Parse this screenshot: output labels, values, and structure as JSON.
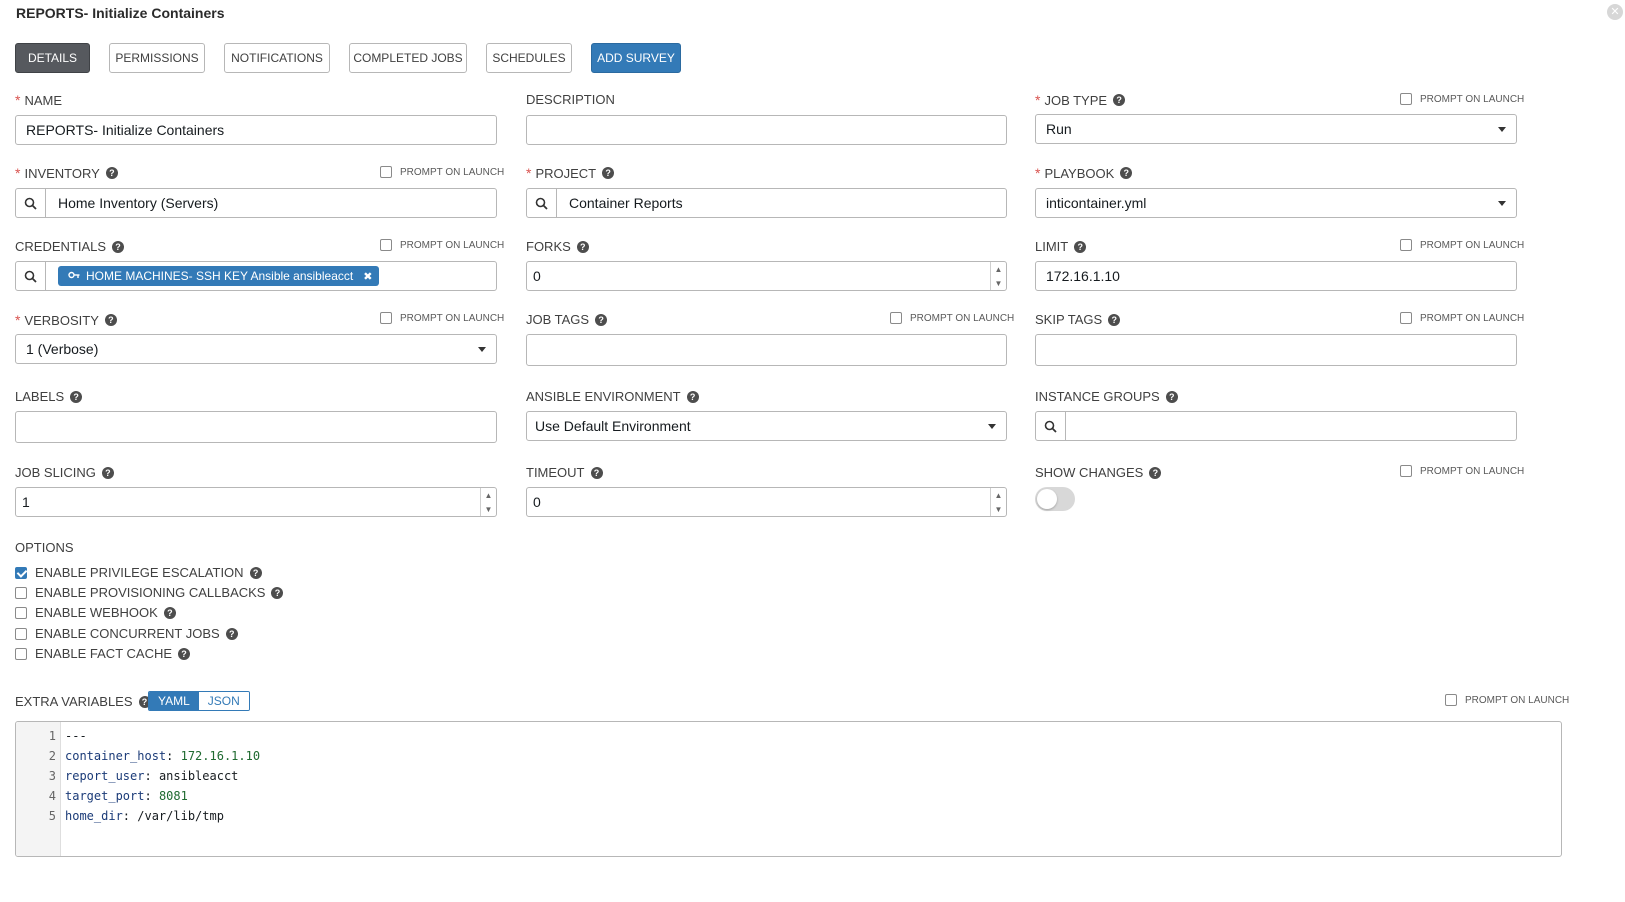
{
  "header": {
    "title": "REPORTS- Initialize Containers"
  },
  "tabs": [
    {
      "label": "DETAILS"
    },
    {
      "label": "PERMISSIONS"
    },
    {
      "label": "NOTIFICATIONS"
    },
    {
      "label": "COMPLETED JOBS"
    },
    {
      "label": "SCHEDULES"
    },
    {
      "label": "ADD SURVEY"
    }
  ],
  "prompt_on_launch": "PROMPT ON LAUNCH",
  "fields": {
    "name": {
      "label": "NAME",
      "value": "REPORTS- Initialize Containers"
    },
    "description": {
      "label": "DESCRIPTION",
      "value": ""
    },
    "job_type": {
      "label": "JOB TYPE",
      "value": "Run"
    },
    "inventory": {
      "label": "INVENTORY",
      "value": "Home Inventory (Servers)"
    },
    "project": {
      "label": "PROJECT",
      "value": "Container Reports"
    },
    "playbook": {
      "label": "PLAYBOOK",
      "value": "inticontainer.yml"
    },
    "credentials": {
      "label": "CREDENTIALS",
      "chip": "HOME MACHINES- SSH KEY Ansible ansibleacct"
    },
    "forks": {
      "label": "FORKS",
      "value": "0"
    },
    "limit": {
      "label": "LIMIT",
      "value": "172.16.1.10"
    },
    "verbosity": {
      "label": "VERBOSITY",
      "value": "1 (Verbose)"
    },
    "job_tags": {
      "label": "JOB TAGS",
      "value": ""
    },
    "skip_tags": {
      "label": "SKIP TAGS",
      "value": ""
    },
    "labels": {
      "label": "LABELS",
      "value": ""
    },
    "ansible_environment": {
      "label": "ANSIBLE ENVIRONMENT",
      "value": "Use Default Environment"
    },
    "instance_groups": {
      "label": "INSTANCE GROUPS",
      "value": ""
    },
    "job_slicing": {
      "label": "JOB SLICING",
      "value": "1"
    },
    "timeout": {
      "label": "TIMEOUT",
      "value": "0"
    },
    "show_changes": {
      "label": "SHOW CHANGES",
      "enabled": false
    }
  },
  "options": {
    "label": "OPTIONS",
    "items": [
      {
        "label": "ENABLE PRIVILEGE ESCALATION",
        "checked": true
      },
      {
        "label": "ENABLE PROVISIONING CALLBACKS",
        "checked": false
      },
      {
        "label": "ENABLE WEBHOOK",
        "checked": false
      },
      {
        "label": "ENABLE CONCURRENT JOBS",
        "checked": false
      },
      {
        "label": "ENABLE FACT CACHE",
        "checked": false
      }
    ]
  },
  "extra_variables": {
    "label": "EXTRA VARIABLES",
    "modes": [
      "YAML",
      "JSON"
    ],
    "active_mode": "YAML",
    "lines": [
      {
        "num": "1",
        "key": "---",
        "value": ""
      },
      {
        "num": "2",
        "key": "container_host",
        "value": "172.16.1.10"
      },
      {
        "num": "3",
        "key": "report_user",
        "value": "ansibleacct"
      },
      {
        "num": "4",
        "key": "target_port",
        "value": "8081"
      },
      {
        "num": "5",
        "key": "home_dir",
        "value": "/var/lib/tmp"
      }
    ]
  },
  "colors": {
    "primary": "#337ab7",
    "active_tab": "#56595e",
    "required": "#d9534f"
  }
}
